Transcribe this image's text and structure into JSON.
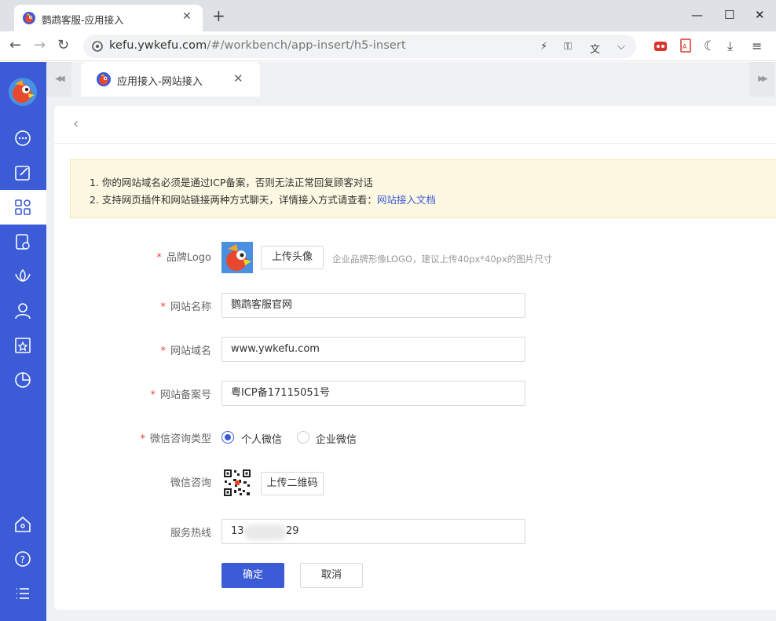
{
  "browser": {
    "tab_title": "鹦鹉客服-应用接入",
    "url_host": "kefu.ywkefu.com",
    "url_path": "/#/workbench/app-insert/h5-insert"
  },
  "app_tab": {
    "title": "应用接入-网站接入"
  },
  "notice": {
    "line1": "1. 你的网站域名必须是通过ICP备案，否则无法正常回复顾客对话",
    "line2_prefix": "2. 支持网页插件和网站链接两种方式聊天，详情接入方式请查看：",
    "line2_link": "网站接入文档"
  },
  "form": {
    "logo_label": "品牌Logo",
    "logo_upload": "上传头像",
    "logo_hint": "企业品牌形像LOGO，建议上传40px*40px的图片尺寸",
    "name_label": "网站名称",
    "name_value": "鹦鹉客服官网",
    "domain_label": "网站域名",
    "domain_value": "www.ywkefu.com",
    "icp_label": "网站备案号",
    "icp_value": "粤ICP备17115051号",
    "wechat_type_label": "微信咨询类型",
    "wechat_type_options": [
      "个人微信",
      "企业微信"
    ],
    "wechat_type_selected": "个人微信",
    "wechat_label": "微信咨询",
    "wechat_upload": "上传二维码",
    "hotline_label": "服务热线",
    "hotline_start": "13",
    "hotline_end": "29",
    "required_mark": "*"
  },
  "actions": {
    "confirm": "确定",
    "cancel": "取消"
  },
  "colors": {
    "primary": "#3c5bd6",
    "required": "#e64545",
    "notice_bg": "#fdf8e2"
  }
}
